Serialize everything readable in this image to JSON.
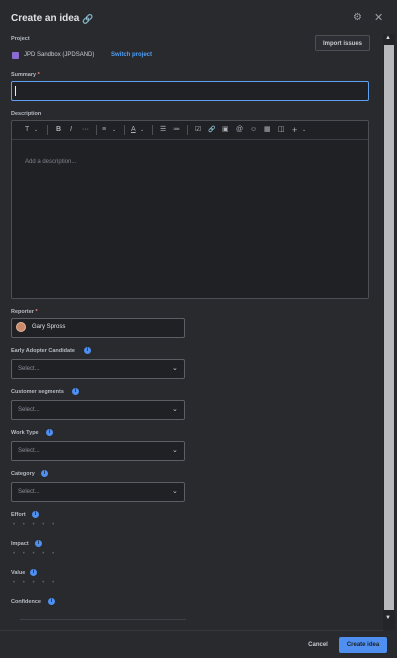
{
  "header": {
    "title": "Create an idea",
    "link_icon": "link-icon",
    "settings_icon": "gear-icon",
    "close_icon": "close-icon"
  },
  "project": {
    "label": "Project",
    "name": "JPD Sandbox (JPDSAND)",
    "switch_label": "Switch project",
    "import_label": "Import issues"
  },
  "summary": {
    "label": "Summary",
    "required_mark": "*",
    "value": ""
  },
  "description": {
    "label": "Description",
    "placeholder": "Add a description...",
    "toolbar": {
      "text_style": "T",
      "bold": "B",
      "italic": "I",
      "more": "···",
      "align": "≡",
      "text_color": "A",
      "bullet_list": "☰",
      "numbered_list": "≔",
      "checkbox": "☑",
      "link": "🔗",
      "image": "▣",
      "mention": "@",
      "emoji": "☺",
      "table": "▦",
      "layout": "◫",
      "insert": "+"
    }
  },
  "reporter": {
    "label": "Reporter",
    "required_mark": "*",
    "value": "Gary Spross"
  },
  "fields": [
    {
      "label": "Early Adopter Candidate",
      "placeholder": "Select..."
    },
    {
      "label": "Customer segments",
      "placeholder": "Select..."
    },
    {
      "label": "Work Type",
      "placeholder": "Select..."
    },
    {
      "label": "Category",
      "placeholder": "Select..."
    }
  ],
  "ratings": [
    {
      "label": "Effort",
      "value": 0,
      "max": 5
    },
    {
      "label": "Impact",
      "value": 0,
      "max": 5
    },
    {
      "label": "Value",
      "value": 0,
      "max": 5
    },
    {
      "label": "Confidence",
      "value": 0,
      "max": 5
    }
  ],
  "rating_dots": "• • • • •",
  "footer": {
    "cancel_label": "Cancel",
    "create_label": "Create idea"
  },
  "colors": {
    "accent": "#4f8ff0",
    "link": "#4f9ff5",
    "required": "#f28b82",
    "background": "#282a2e"
  }
}
